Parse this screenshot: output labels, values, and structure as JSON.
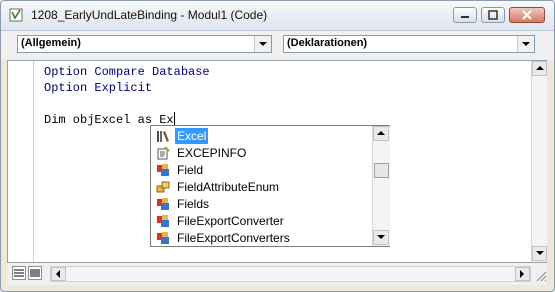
{
  "window": {
    "title": "1208_EarlyUndLateBinding - Modul1 (Code)",
    "buttons": {
      "minimize": "minimize-icon",
      "maximize": "maximize-icon",
      "close": "close-icon"
    }
  },
  "object_combo": {
    "value": "(Allgemein)"
  },
  "procedure_combo": {
    "value": "(Deklarationen)"
  },
  "code": {
    "line1_keyword": "Option Compare Database",
    "line2_keyword": "Option Explicit",
    "line3_prefix": "Dim objExcel as Ex"
  },
  "autocomplete": {
    "items": [
      {
        "label": "Excel",
        "icon": "library-icon",
        "selected": true
      },
      {
        "label": "EXCEPINFO",
        "icon": "type-icon",
        "selected": false
      },
      {
        "label": "Field",
        "icon": "class-icon",
        "selected": false
      },
      {
        "label": "FieldAttributeEnum",
        "icon": "enum-icon",
        "selected": false
      },
      {
        "label": "Fields",
        "icon": "class-icon",
        "selected": false
      },
      {
        "label": "FileExportConverter",
        "icon": "class-icon",
        "selected": false
      },
      {
        "label": "FileExportConverters",
        "icon": "class-icon",
        "selected": false
      }
    ]
  },
  "colors": {
    "selection": "#3399ff",
    "keyword": "#000080"
  }
}
